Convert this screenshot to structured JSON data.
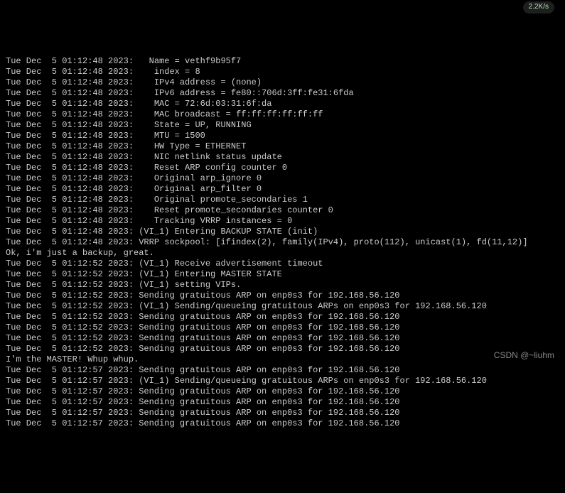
{
  "badge": {
    "speed": "2.2K/s"
  },
  "watermark": "CSDN @~liuhm",
  "lines": [
    "Tue Dec  5 01:12:48 2023:   Name = vethf9b95f7",
    "Tue Dec  5 01:12:48 2023:    index = 8",
    "Tue Dec  5 01:12:48 2023:    IPv4 address = (none)",
    "Tue Dec  5 01:12:48 2023:    IPv6 address = fe80::706d:3ff:fe31:6fda",
    "Tue Dec  5 01:12:48 2023:    MAC = 72:6d:03:31:6f:da",
    "Tue Dec  5 01:12:48 2023:    MAC broadcast = ff:ff:ff:ff:ff:ff",
    "Tue Dec  5 01:12:48 2023:    State = UP, RUNNING",
    "Tue Dec  5 01:12:48 2023:    MTU = 1500",
    "Tue Dec  5 01:12:48 2023:    HW Type = ETHERNET",
    "Tue Dec  5 01:12:48 2023:    NIC netlink status update",
    "Tue Dec  5 01:12:48 2023:    Reset ARP config counter 0",
    "Tue Dec  5 01:12:48 2023:    Original arp_ignore 0",
    "Tue Dec  5 01:12:48 2023:    Original arp_filter 0",
    "Tue Dec  5 01:12:48 2023:    Original promote_secondaries 1",
    "Tue Dec  5 01:12:48 2023:    Reset promote_secondaries counter 0",
    "Tue Dec  5 01:12:48 2023:    Tracking VRRP instances = 0",
    "Tue Dec  5 01:12:48 2023: (VI_1) Entering BACKUP STATE (init)",
    "Tue Dec  5 01:12:48 2023: VRRP sockpool: [ifindex(2), family(IPv4), proto(112), unicast(1), fd(11,12)]",
    "Ok, i'm just a backup, great.",
    "Tue Dec  5 01:12:52 2023: (VI_1) Receive advertisement timeout",
    "Tue Dec  5 01:12:52 2023: (VI_1) Entering MASTER STATE",
    "Tue Dec  5 01:12:52 2023: (VI_1) setting VIPs.",
    "Tue Dec  5 01:12:52 2023: Sending gratuitous ARP on enp0s3 for 192.168.56.120",
    "Tue Dec  5 01:12:52 2023: (VI_1) Sending/queueing gratuitous ARPs on enp0s3 for 192.168.56.120",
    "Tue Dec  5 01:12:52 2023: Sending gratuitous ARP on enp0s3 for 192.168.56.120",
    "Tue Dec  5 01:12:52 2023: Sending gratuitous ARP on enp0s3 for 192.168.56.120",
    "Tue Dec  5 01:12:52 2023: Sending gratuitous ARP on enp0s3 for 192.168.56.120",
    "Tue Dec  5 01:12:52 2023: Sending gratuitous ARP on enp0s3 for 192.168.56.120",
    "I'm the MASTER! Whup whup.",
    "Tue Dec  5 01:12:57 2023: Sending gratuitous ARP on enp0s3 for 192.168.56.120",
    "Tue Dec  5 01:12:57 2023: (VI_1) Sending/queueing gratuitous ARPs on enp0s3 for 192.168.56.120",
    "Tue Dec  5 01:12:57 2023: Sending gratuitous ARP on enp0s3 for 192.168.56.120",
    "Tue Dec  5 01:12:57 2023: Sending gratuitous ARP on enp0s3 for 192.168.56.120",
    "Tue Dec  5 01:12:57 2023: Sending gratuitous ARP on enp0s3 for 192.168.56.120",
    "Tue Dec  5 01:12:57 2023: Sending gratuitous ARP on enp0s3 for 192.168.56.120"
  ]
}
